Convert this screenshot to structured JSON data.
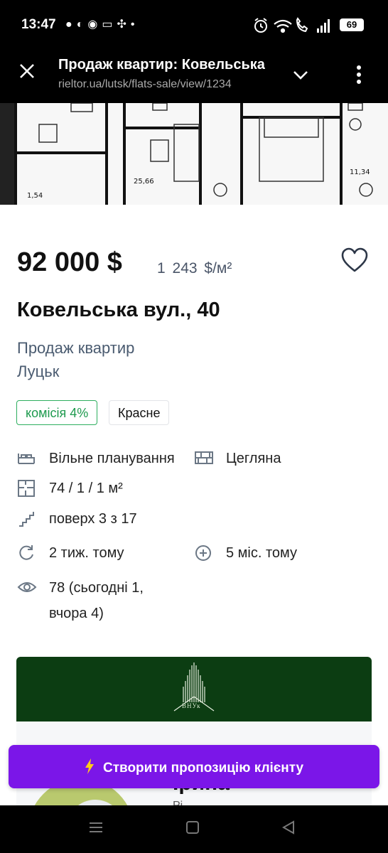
{
  "status_bar": {
    "time": "13:47",
    "battery": "69",
    "left_icons": [
      "chat-icon",
      "viber-icon",
      "telegram-icon",
      "pumb-icon",
      "fan-icon",
      "dot-icon"
    ],
    "right_icons": [
      "alarm-icon",
      "wifi-icon",
      "call-icon",
      "signal-icon",
      "battery-icon"
    ]
  },
  "browser": {
    "title": "Продаж квартир: Ковельська",
    "url": "rieltor.ua/lutsk/flats-sale/view/1234"
  },
  "listing": {
    "price": "92 000 $",
    "price_per_sqm": "1 243 $/м²",
    "address": "Ковельська вул., 40",
    "category": "Продаж квартир",
    "city": "Луцьк",
    "tags": [
      "комісія 4%",
      "Красне"
    ],
    "features": {
      "layout": "Вільне планування",
      "wall": "Цегляна",
      "area": "74 / 1 / 1 м²",
      "floor": "поверх 3 з 17",
      "updated": "2 тиж. тому",
      "added": "5 міс. тому",
      "views_line1": "78 (сьогодні 1,",
      "views_line2": "вчора 4)"
    }
  },
  "agency": {
    "name": "ВНУк"
  },
  "agent": {
    "name": "Ірина",
    "subtitle": "Рі"
  },
  "cta": {
    "label": "Створити пропозицію клієнту"
  },
  "colors": {
    "accent_purple": "#7b16e8",
    "tag_green": "#1e9a4e",
    "agency_green": "#0c3d12"
  }
}
